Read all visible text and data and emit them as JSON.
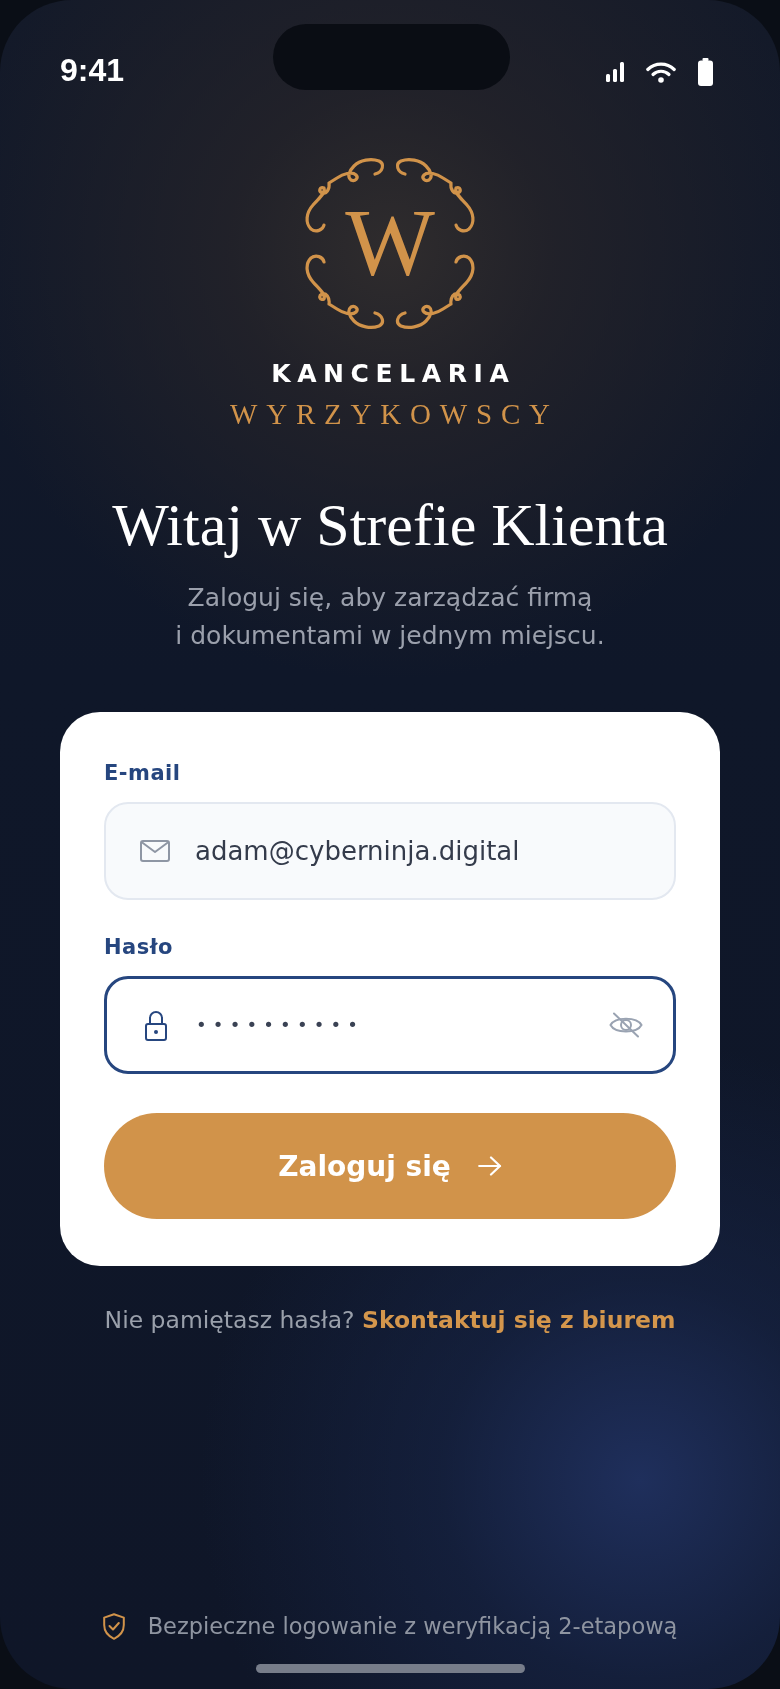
{
  "status_bar": {
    "time": "9:41"
  },
  "brand": {
    "monogram": "W",
    "name": "KANCELARIA",
    "surname": "WYRZYKOWSCY"
  },
  "heading": {
    "title": "Witaj w Strefie Klienta",
    "subtitle": "Zaloguj się, aby zarządzać firmą\ni dokumentami w jednym miejscu."
  },
  "form": {
    "fields": [
      {
        "kind": "email",
        "label": "E-mail",
        "value": "adam@cyberninja.digital",
        "focused": false
      },
      {
        "kind": "password",
        "label": "Hasło",
        "value": "••••••••••",
        "focused": true
      }
    ],
    "submit": {
      "label": "Zaloguj się"
    }
  },
  "help": {
    "text": "Nie pamiętasz hasła?",
    "link": "Skontaktuj się z biurem"
  },
  "footer": {
    "note": "Bezpieczne logowanie z weryfikacją 2-etapową"
  }
}
